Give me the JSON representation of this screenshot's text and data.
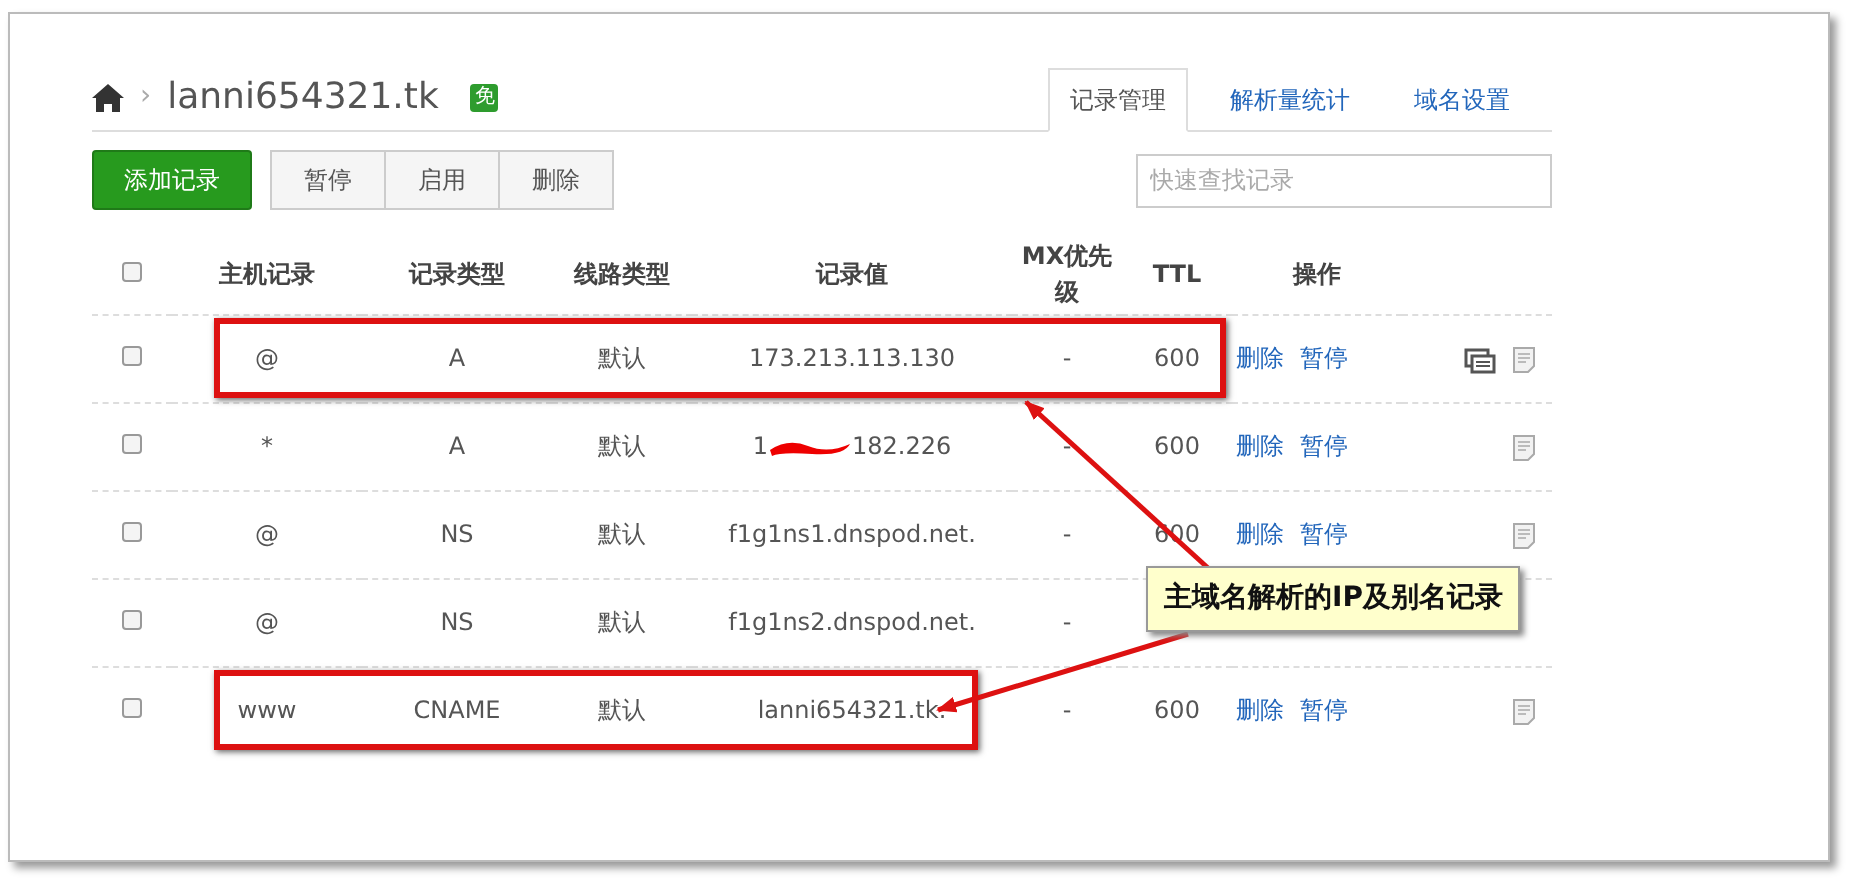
{
  "breadcrumb": {
    "separator": "›",
    "domain": "lanni654321.tk",
    "badge": "免"
  },
  "tabs": [
    {
      "label": "记录管理",
      "selected": true
    },
    {
      "label": "解析量统计",
      "selected": false
    },
    {
      "label": "域名设置",
      "selected": false
    }
  ],
  "toolbar": {
    "primary": "添加记录",
    "buttons": [
      "暂停",
      "启用",
      "删除"
    ]
  },
  "search": {
    "placeholder": "快速查找记录"
  },
  "table": {
    "select_all": {
      "checked": false
    },
    "columns": [
      "主机记录",
      "记录类型",
      "线路类型",
      "记录值",
      "MX优先级",
      "TTL",
      "操作"
    ],
    "rows": [
      {
        "checked": false,
        "host": "@",
        "type": "A",
        "line": "默认",
        "value": [
          "173.213.113.130"
        ],
        "redacted": false,
        "mx": "-",
        "ttl": "600",
        "actions": [
          "删除",
          "暂停"
        ],
        "stack_icon": true,
        "note_icon": true,
        "highlighted": true,
        "highlight_covers_ttl": true
      },
      {
        "checked": false,
        "host": "*",
        "type": "A",
        "line": "默认",
        "value": [
          "1",
          "182.226"
        ],
        "redacted": true,
        "mx": "-",
        "ttl": "600",
        "actions": [
          "删除",
          "暂停"
        ],
        "stack_icon": false,
        "note_icon": true,
        "highlighted": false
      },
      {
        "checked": false,
        "host": "@",
        "type": "NS",
        "line": "默认",
        "value": [
          "f1g1ns1.dnspod.net."
        ],
        "redacted": false,
        "mx": "-",
        "ttl": "600",
        "actions": [
          "删除",
          "暂停"
        ],
        "stack_icon": false,
        "note_icon": true,
        "highlighted": false
      },
      {
        "checked": false,
        "host": "@",
        "type": "NS",
        "line": "默认",
        "value": [
          "f1g1ns2.dnspod.net."
        ],
        "redacted": false,
        "mx": "-",
        "highlighted": false
      },
      {
        "checked": false,
        "host": "www",
        "type": "CNAME",
        "line": "默认",
        "value": [
          "lanni654321.tk."
        ],
        "redacted": false,
        "mx": "-",
        "ttl": "600",
        "actions": [
          "删除",
          "暂停"
        ],
        "stack_icon": false,
        "note_icon": true,
        "highlighted": true,
        "highlight_covers_ttl": false
      }
    ]
  },
  "annotation": {
    "text": "主域名解析的IP及别名记录"
  }
}
